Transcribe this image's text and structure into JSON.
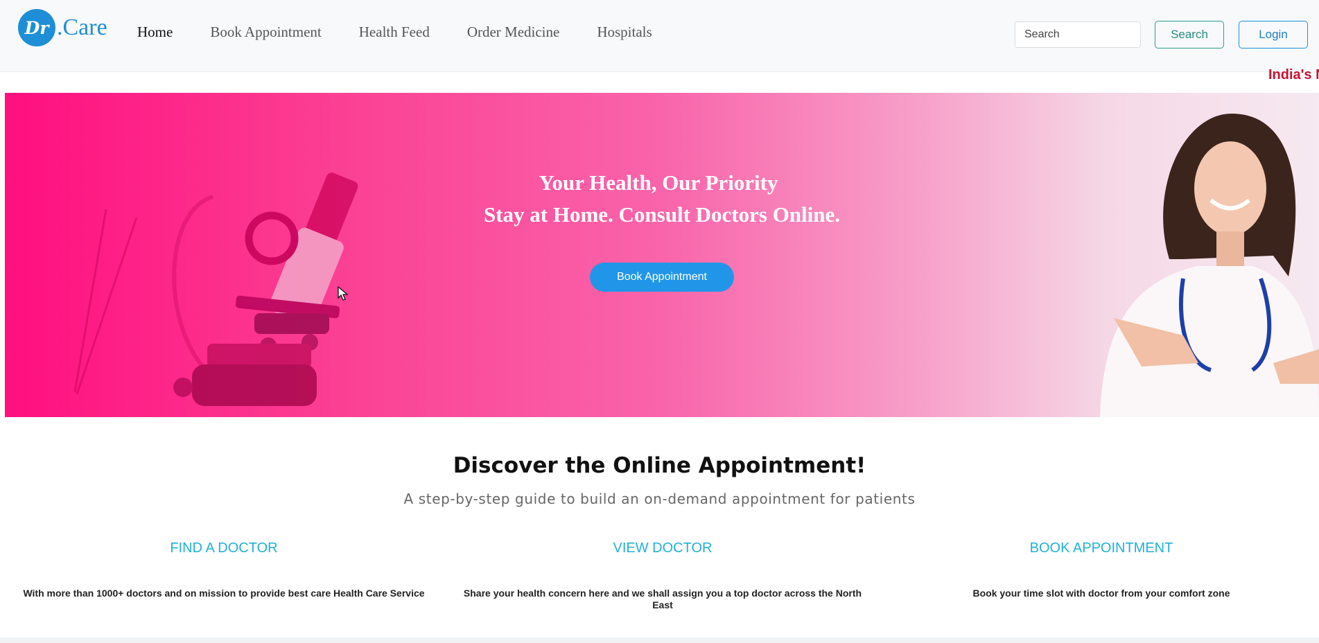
{
  "navbar": {
    "logo": {
      "badge": "Dr",
      "text": ".Care"
    },
    "links": [
      {
        "label": "Home"
      },
      {
        "label": "Book Appointment"
      },
      {
        "label": "Health Feed"
      },
      {
        "label": "Order Medicine"
      },
      {
        "label": "Hospitals"
      }
    ],
    "search_placeholder": "Search",
    "search_button": "Search",
    "login_button": "Login"
  },
  "marquee": {
    "text": "India's N"
  },
  "hero": {
    "title": "Your Health, Our Priority",
    "subtitle": "Stay at Home. Consult Doctors Online.",
    "button": "Book Appointment"
  },
  "discover": {
    "title": "Discover the Online Appointment!",
    "subtitle": "A step-by-step guide to build an on-demand appointment for patients",
    "features": [
      {
        "title": "FIND A DOCTOR",
        "description": "With more than 1000+ doctors and on mission to provide best care Health Care Service"
      },
      {
        "title": "VIEW DOCTOR",
        "description": "Share your health concern here and we shall assign you a top doctor across the North East"
      },
      {
        "title": "BOOK APPOINTMENT",
        "description": "Book your time slot with doctor from your comfort zone"
      }
    ]
  },
  "colors": {
    "brand": "#1e8fd6",
    "hero_pink": "#ff0f7f",
    "accent_cyan": "#1fb1d6",
    "marquee_red": "#c8102e"
  }
}
